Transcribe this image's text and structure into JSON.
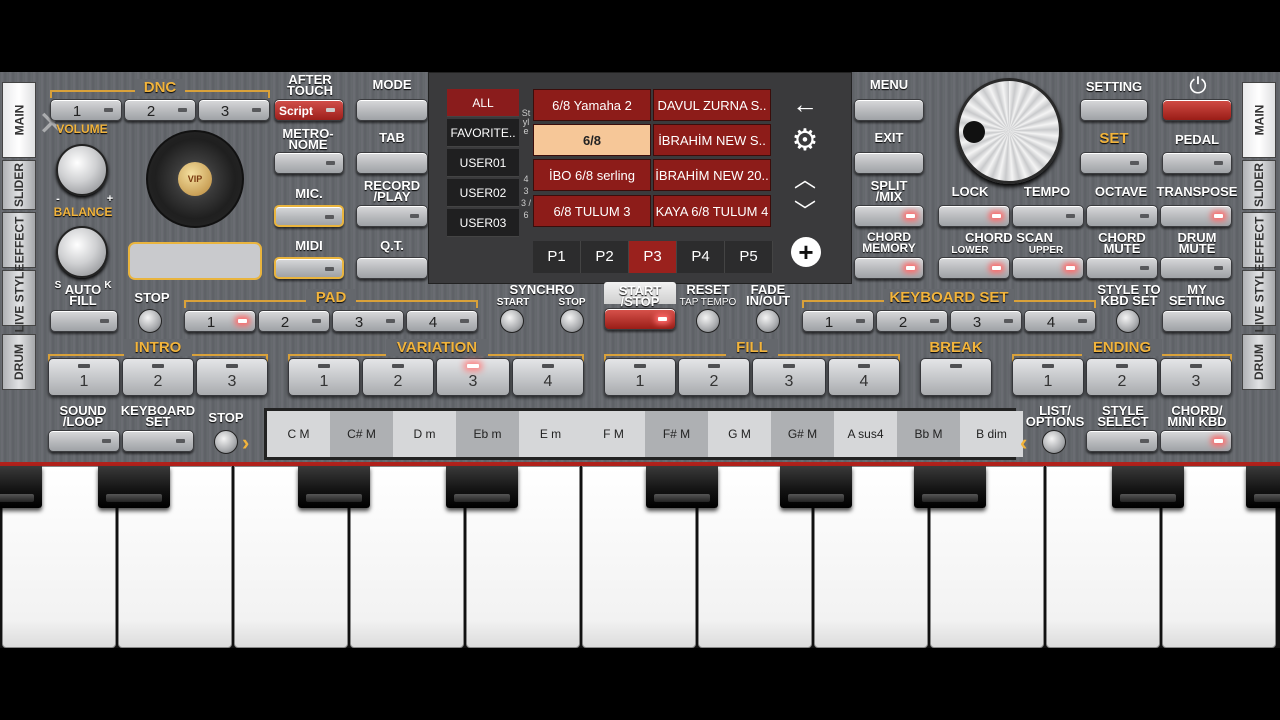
{
  "dnc": {
    "label": "DNC",
    "b1": "1",
    "b2": "2",
    "b3": "3"
  },
  "after_touch": {
    "label": "AFTER TOUCH",
    "value": "Script"
  },
  "volume_label": "VOLUME",
  "balance_label": "BALANCE",
  "balance_s": "S",
  "balance_k": "K",
  "minus": "-",
  "plus": "+",
  "vip": "VIP",
  "metronome_label": "METRO- NOME",
  "mic_label": "MIC.",
  "midi_label": "MIDI",
  "auto_fill_label": "AUTO FILL",
  "stop_label": "STOP",
  "pad": {
    "label": "PAD",
    "b1": "1",
    "b2": "2",
    "b3": "3",
    "b4": "4"
  },
  "synchro": {
    "label": "SYNCHRO",
    "start": "START",
    "stop": "STOP"
  },
  "start_stop_label": "START /STOP",
  "reset": {
    "label": "RESET",
    "sub": "TAP TEMPO"
  },
  "fade_label": "FADE IN/OUT",
  "keyboard_set": {
    "label": "KEYBOARD SET",
    "b1": "1",
    "b2": "2",
    "b3": "3",
    "b4": "4"
  },
  "style_to_kbd": "STYLE TO KBD SET",
  "my_setting": "MY SETTING",
  "intro": {
    "label": "INTRO",
    "b": [
      "1",
      "2",
      "3"
    ]
  },
  "variation": {
    "label": "VARIATION",
    "b": [
      "1",
      "2",
      "3",
      "4"
    ]
  },
  "fill": {
    "label": "FILL",
    "b": [
      "1",
      "2",
      "3",
      "4"
    ]
  },
  "break_label": "BREAK",
  "ending": {
    "label": "ENDING",
    "b": [
      "1",
      "2",
      "3"
    ]
  },
  "sound_loop": "SOUND /LOOP",
  "keyboard_set_btn": "KEYBOARD SET",
  "stop2": "STOP",
  "chords": [
    "C M",
    "C# M",
    "D m",
    "Eb m",
    "E m",
    "F M",
    "F# M",
    "G M",
    "G# M",
    "A sus4",
    "Bb M",
    "B dim"
  ],
  "list_options": "LIST/ OPTIONS",
  "style_select": "STYLE SELECT",
  "chord_mini": "CHORD/ MINI KBD",
  "mode": "MODE",
  "tab": "TAB",
  "record_play": "RECORD /PLAY",
  "qt": "Q.T.",
  "categories": [
    "ALL",
    "FAVORITE..",
    "USER01",
    "USER02",
    "USER03"
  ],
  "side_letters": "Style",
  "side_nums": "4 3 3 / 6",
  "styles": [
    [
      "6/8 Yamaha 2",
      "DAVUL ZURNA S.."
    ],
    [
      "6/8",
      "İBRAHİM NEW S.."
    ],
    [
      "İBO 6/8 serling",
      "İBRAHİM NEW 20.."
    ],
    [
      "6/8 TULUM 3",
      "KAYA 6/8 TULUM 4"
    ]
  ],
  "pages": [
    "P1",
    "P2",
    "P3",
    "P4",
    "P5"
  ],
  "menu": "MENU",
  "exit": "EXIT",
  "split_mix": "SPLIT /MIX",
  "chord_memory": "CHORD MEMORY",
  "setting": "SETTING",
  "set": "SET",
  "pedal": "PEDAL",
  "lock": "LOCK",
  "tempo": "TEMPO",
  "octave": "OCTAVE",
  "transpose": "TRANSPOSE",
  "chord_scan": "CHORD SCAN",
  "lower": "LOWER",
  "upper": "UPPER",
  "chord_mute": "CHORD MUTE",
  "drum_mute": "DRUM MUTE",
  "left_tabs": [
    "MAIN",
    "SLIDER",
    "EFFECT",
    "LIVE STYLE",
    "DRUM"
  ],
  "right_tabs": [
    "MAIN",
    "SLIDER",
    "EFFECT",
    "LIVE STYLE",
    "DRUM"
  ]
}
